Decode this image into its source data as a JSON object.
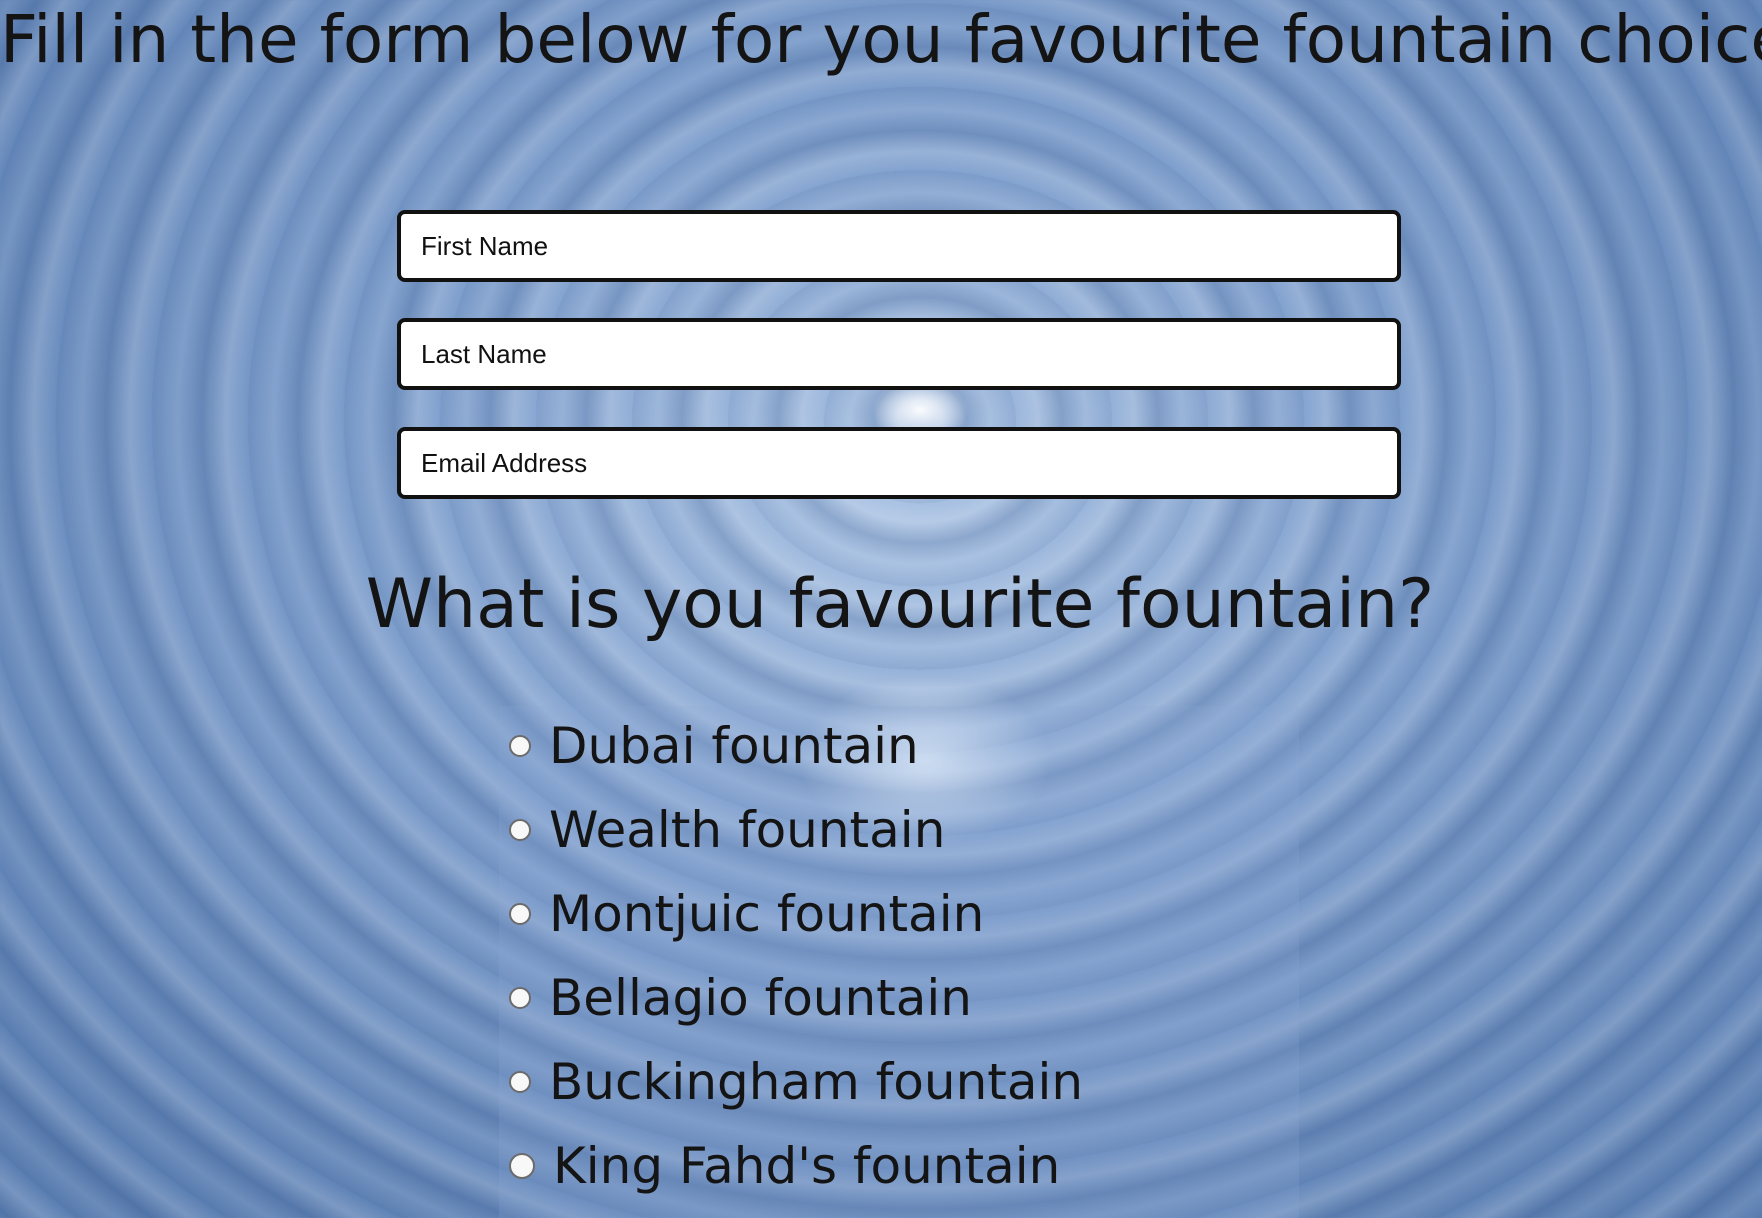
{
  "page": {
    "title": "Fill in the form below for you favourite fountain choice"
  },
  "form": {
    "first_name_placeholder": "First Name",
    "last_name_placeholder": "Last Name",
    "email_placeholder": "Email Address"
  },
  "question": {
    "heading": "What is you favourite fountain?",
    "options": [
      "Dubai fountain",
      "Wealth fountain",
      "Montjuic fountain",
      "Bellagio fountain",
      "Buckingham fountain",
      "King Fahd's fountain"
    ]
  }
}
